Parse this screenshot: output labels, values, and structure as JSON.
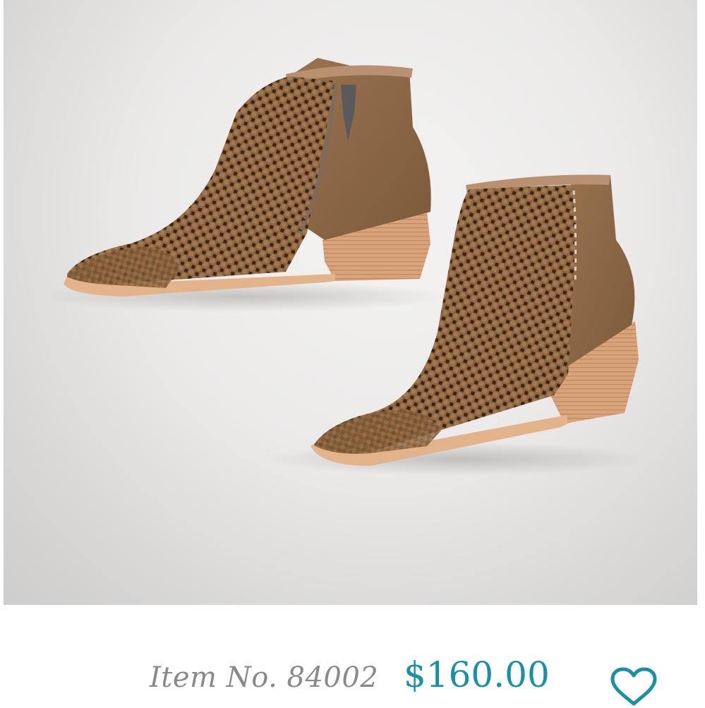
{
  "product": {
    "image_alt": "Brown woven leather ankle booties with stacked heels",
    "item_number": "Item No. 84002",
    "price": "$160.00",
    "wishlist_icon": "heart-outline-icon"
  },
  "colors": {
    "price": "#1a8fa6",
    "item_number": "#8a8a8a",
    "heart": "#1a8fa6",
    "leather": "#8a6440",
    "heel": "#dcaa82"
  }
}
